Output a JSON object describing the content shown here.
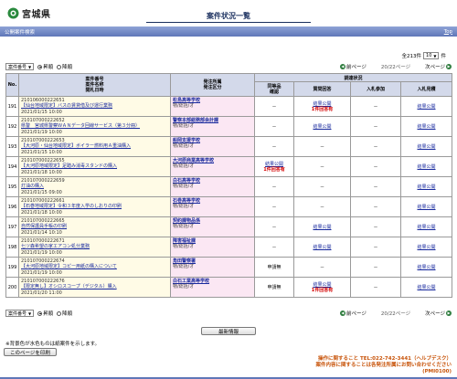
{
  "header": {
    "logo_text": "宮城県",
    "page_title": "案件状況一覧"
  },
  "bar": {
    "left_label": "公開案件検索",
    "top_link": "Top"
  },
  "count": {
    "prefix": "全213件",
    "per_page": "10",
    "suffix": "件"
  },
  "nav": {
    "sort_select": "案件番号",
    "asc_label": "昇順",
    "desc_label": "降順",
    "prev_label": "前ページ",
    "page_info": "20/22ページ",
    "next_label": "次ページ"
  },
  "table": {
    "headers": {
      "no": "No.",
      "case": "案件番号\n案件名称\n開札日時",
      "org": "発注所属\n発注区分",
      "status_group": "調達状況",
      "confirm": "同等品\n確認",
      "question": "質問回答",
      "entry": "入札参加",
      "result": "入札見積"
    },
    "rows": [
      {
        "no": "191",
        "num": "210106000222651",
        "name": "【仙台地域限定】バスの賃貸借及び運行業務",
        "date": "2021/01/15 10:00",
        "org": "松島高等学校",
        "div": "物/総括/オ",
        "confirm": "－",
        "question": "結果公開",
        "question_note": "1件回答有",
        "entry": "－",
        "result": "結果公開"
      },
      {
        "no": "192",
        "num": "210107000222652",
        "name": "県警　宮城県警察ＷＡＮデータ回線サービス（第３分冊）",
        "date": "2021/01/19 10:00",
        "org": "警察本部総務部会計課",
        "div": "物/総括/オ",
        "confirm": "－",
        "question": "結果公開",
        "question_note": "",
        "entry": "－",
        "result": "結果公開"
      },
      {
        "no": "193",
        "num": "210107000222653",
        "name": "【大河原・仙台地域限定】ボイラー燃料用Ａ重油購入",
        "date": "2021/01/15 10:00",
        "org": "船岡支援学校",
        "div": "物/総括/オ",
        "confirm": "－",
        "question": "－",
        "question_note": "",
        "entry": "－",
        "result": "結果公開"
      },
      {
        "no": "194",
        "num": "210107000222655",
        "name": "【大河原地域限定】足踏み消毒スタンドの購入",
        "date": "2021/01/18 10:00",
        "org": "大河原商業高等学校",
        "div": "物/総括/オ",
        "confirm": "結果公開",
        "confirm_note": "1件回答有",
        "question": "－",
        "question_note": "",
        "entry": "－",
        "result": "結果公開"
      },
      {
        "no": "195",
        "num": "210107000222659",
        "name": "灯油の購入",
        "date": "2021/01/15 09:00",
        "org": "白石高等学校",
        "div": "物/総括/オ",
        "confirm": "－",
        "question": "－",
        "question_note": "",
        "entry": "－",
        "result": "結果公開"
      },
      {
        "no": "196",
        "num": "210107000222661",
        "name": "【石巻地域限定】令和３年度入学のしおりの印刷",
        "date": "2021/01/18 10:00",
        "org": "石巻高等学校",
        "div": "物/総括/オ",
        "confirm": "－",
        "question": "－",
        "question_note": "",
        "entry": "－",
        "result": "結果公開"
      },
      {
        "no": "197",
        "num": "210107000222665",
        "name": "自然保護員手帳の印刷",
        "date": "2021/01/14 10:10",
        "org": "契約課物品係",
        "div": "物/総括/オ",
        "confirm": "－",
        "question": "結果公開",
        "question_note": "",
        "entry": "－",
        "result": "結果公開"
      },
      {
        "no": "198",
        "num": "210107000222671",
        "name": "七ツ森希望の家エアコン処分業務",
        "date": "2021/01/19 10:00",
        "org": "障害福祉課",
        "div": "物/総括/オ",
        "confirm": "－",
        "question": "結果公開",
        "question_note": "",
        "entry": "－",
        "result": "結果公開"
      },
      {
        "no": "199",
        "num": "210107000222674",
        "name": "【大河原地域限定】コピー用紙の購入について",
        "date": "2021/01/19 10:00",
        "org": "角田警察署",
        "div": "物/総括/オ",
        "confirm": "申請無",
        "question": "－",
        "question_note": "",
        "entry": "－",
        "result": "結果公開"
      },
      {
        "no": "200",
        "num": "210107000222676",
        "name": "【限定無し】オシロスコープ（デジタル）購入",
        "date": "2021/01/20 11:00",
        "org": "白石工業高等学校",
        "div": "物/総括/オ",
        "confirm": "申請無",
        "question": "結果公開",
        "question_note": "1件回答有",
        "entry": "－",
        "result": "結果公開"
      }
    ]
  },
  "bottom": {
    "latest_button": "最新情報",
    "note": "※背景色が水色ものは紙案件を示します。",
    "back_button": "このページを印刷",
    "footer_line1": "操作に関すること TEL:022-742-3441（ヘルプデスク）",
    "footer_line2": "案件内容に関することは各発注所属にお問い合わせください",
    "footer_line3": "(PMI0100)"
  },
  "colors": {
    "accent": "#5f77b8",
    "header_cell": "#d3d9ea",
    "case_bg": "#fffbe6",
    "org_bg": "#fbe7f3",
    "note_red": "#d40000",
    "footer_orange": "#c8540a"
  }
}
